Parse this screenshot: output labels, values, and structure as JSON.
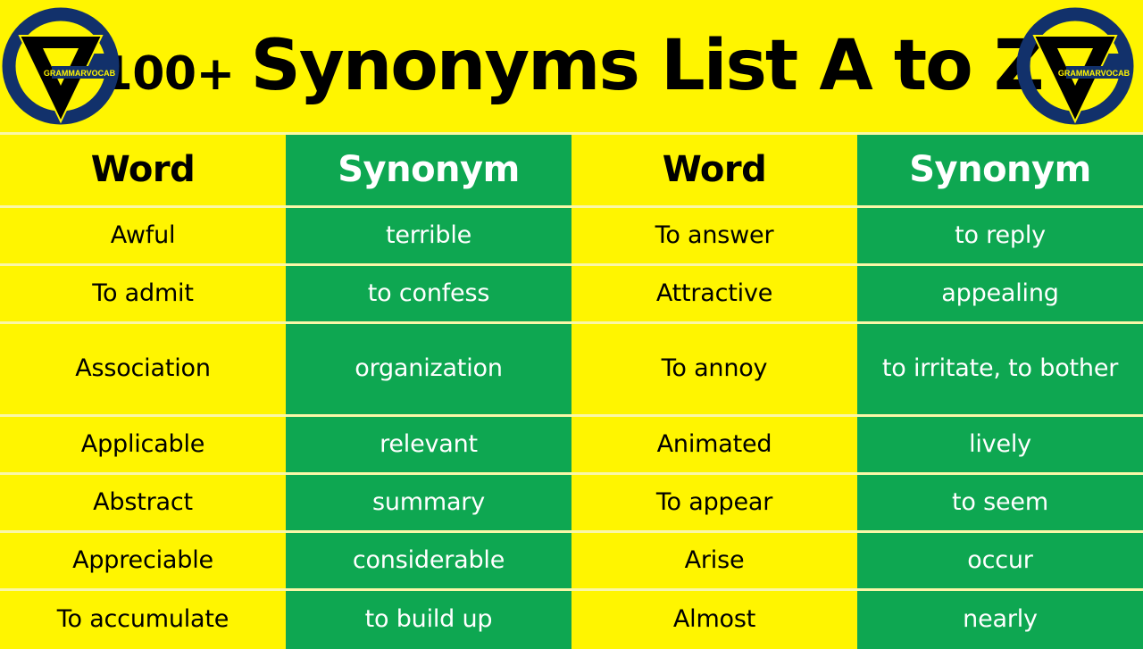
{
  "header": {
    "count_label": "100+",
    "title": "Synonyms List A to Z",
    "logo_text": "GRAMMARVOCAB",
    "brand_navy": "#12316B",
    "brand_black": "#000000",
    "background": "#FFF500"
  },
  "table": {
    "columns": [
      "Word",
      "Synonym",
      "Word",
      "Synonym"
    ],
    "rows": [
      {
        "word_left": "Awful",
        "syn_left": "terrible",
        "word_right": "To answer",
        "syn_right": "to reply"
      },
      {
        "word_left": "To admit",
        "syn_left": "to confess",
        "word_right": "Attractive",
        "syn_right": "appealing"
      },
      {
        "word_left": "Association",
        "syn_left": "organization",
        "word_right": "To annoy",
        "syn_right": "to irritate, to bother"
      },
      {
        "word_left": "Applicable",
        "syn_left": "relevant",
        "word_right": "Animated",
        "syn_right": "lively"
      },
      {
        "word_left": "Abstract",
        "syn_left": "summary",
        "word_right": "To appear",
        "syn_right": "to seem"
      },
      {
        "word_left": "Appreciable",
        "syn_left": "considerable",
        "word_right": "Arise",
        "syn_right": "occur"
      },
      {
        "word_left": "To accumulate",
        "syn_left": "to build up",
        "word_right": "Almost",
        "syn_right": "nearly"
      }
    ],
    "colors": {
      "word_bg": "#FFF500",
      "word_fg": "#000000",
      "synonym_bg": "#0EA751",
      "synonym_fg": "#FFFFFF",
      "divider": "#FAF7A8"
    }
  }
}
